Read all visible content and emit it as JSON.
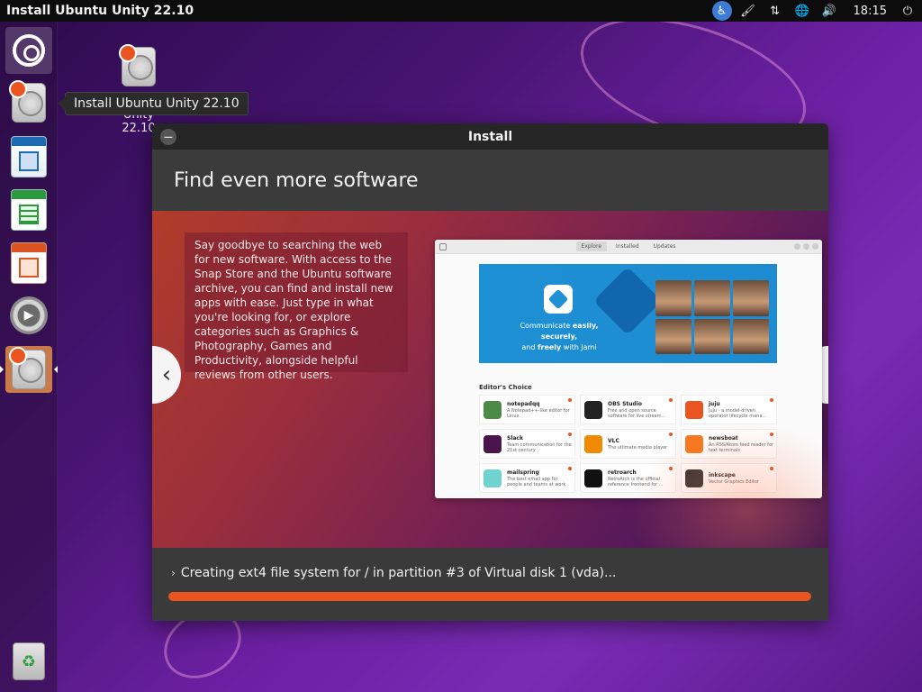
{
  "top_panel": {
    "title": "Install Ubuntu Unity 22.10",
    "clock": "18:15",
    "tray_icons": [
      "accessibility-icon",
      "paint-brush-icon",
      "network-icon",
      "globe-icon",
      "volume-icon",
      "power-icon"
    ]
  },
  "launcher": {
    "items": [
      {
        "name": "dash-home",
        "active": true
      },
      {
        "name": "install-ubuntu"
      },
      {
        "name": "libreoffice-writer"
      },
      {
        "name": "libreoffice-calc"
      },
      {
        "name": "libreoffice-impress"
      },
      {
        "name": "settings"
      },
      {
        "name": "install-ubuntu-running",
        "active": true
      },
      {
        "name": "trash"
      }
    ]
  },
  "tooltip": {
    "text": "Install Ubuntu Unity 22.10"
  },
  "desktop_icon": {
    "label": "Unity 22.10"
  },
  "window": {
    "title": "Install",
    "slide_title": "Find even more software",
    "slide_description": "Say goodbye to searching the web for new software. With access to the Snap Store and the Ubuntu software archive, you can find and install new apps with ease. Just type in what you're looking for, or explore categories such as Graphics & Photography, Games and Productivity, alongside helpful reviews from other users.",
    "nav_prev": "‹",
    "nav_next": "›",
    "status_text": "Creating ext4 file system for / in partition #3 of Virtual disk 1 (vda)...",
    "progress": 1.0
  },
  "store_preview": {
    "tabs": [
      "Explore",
      "Installed",
      "Updates"
    ],
    "banner_line1": "Communicate",
    "banner_easily": "easily, securely,",
    "banner_line2": "and",
    "banner_freely": "freely",
    "banner_line3": "with Jami",
    "editors_choice": "Editor's Choice",
    "apps": [
      {
        "name": "notepadqq",
        "desc": "A Notepad++-like editor for Linux.",
        "color": "#4c8a47"
      },
      {
        "name": "OBS Studio",
        "desc": "Free and open source software for live stream...",
        "color": "#222222"
      },
      {
        "name": "juju",
        "desc": "Juju - a model-driven operator lifecycle mana...",
        "color": "#e95420"
      },
      {
        "name": "Slack",
        "desc": "Team communication for the 21st century",
        "color": "#4a154b"
      },
      {
        "name": "VLC",
        "desc": "The ultimate media player",
        "color": "#f08a00"
      },
      {
        "name": "newsboat",
        "desc": "An RSS/Atom feed reader for text terminals",
        "color": "#f47920"
      },
      {
        "name": "mailspring",
        "desc": "The best email app for people and teams at work",
        "color": "#6fd3d0"
      },
      {
        "name": "retroarch",
        "desc": "RetroArch is the official reference frontend for ...",
        "color": "#111111"
      },
      {
        "name": "inkscape",
        "desc": "Vector Graphics Editor",
        "color": "#333333"
      }
    ]
  }
}
